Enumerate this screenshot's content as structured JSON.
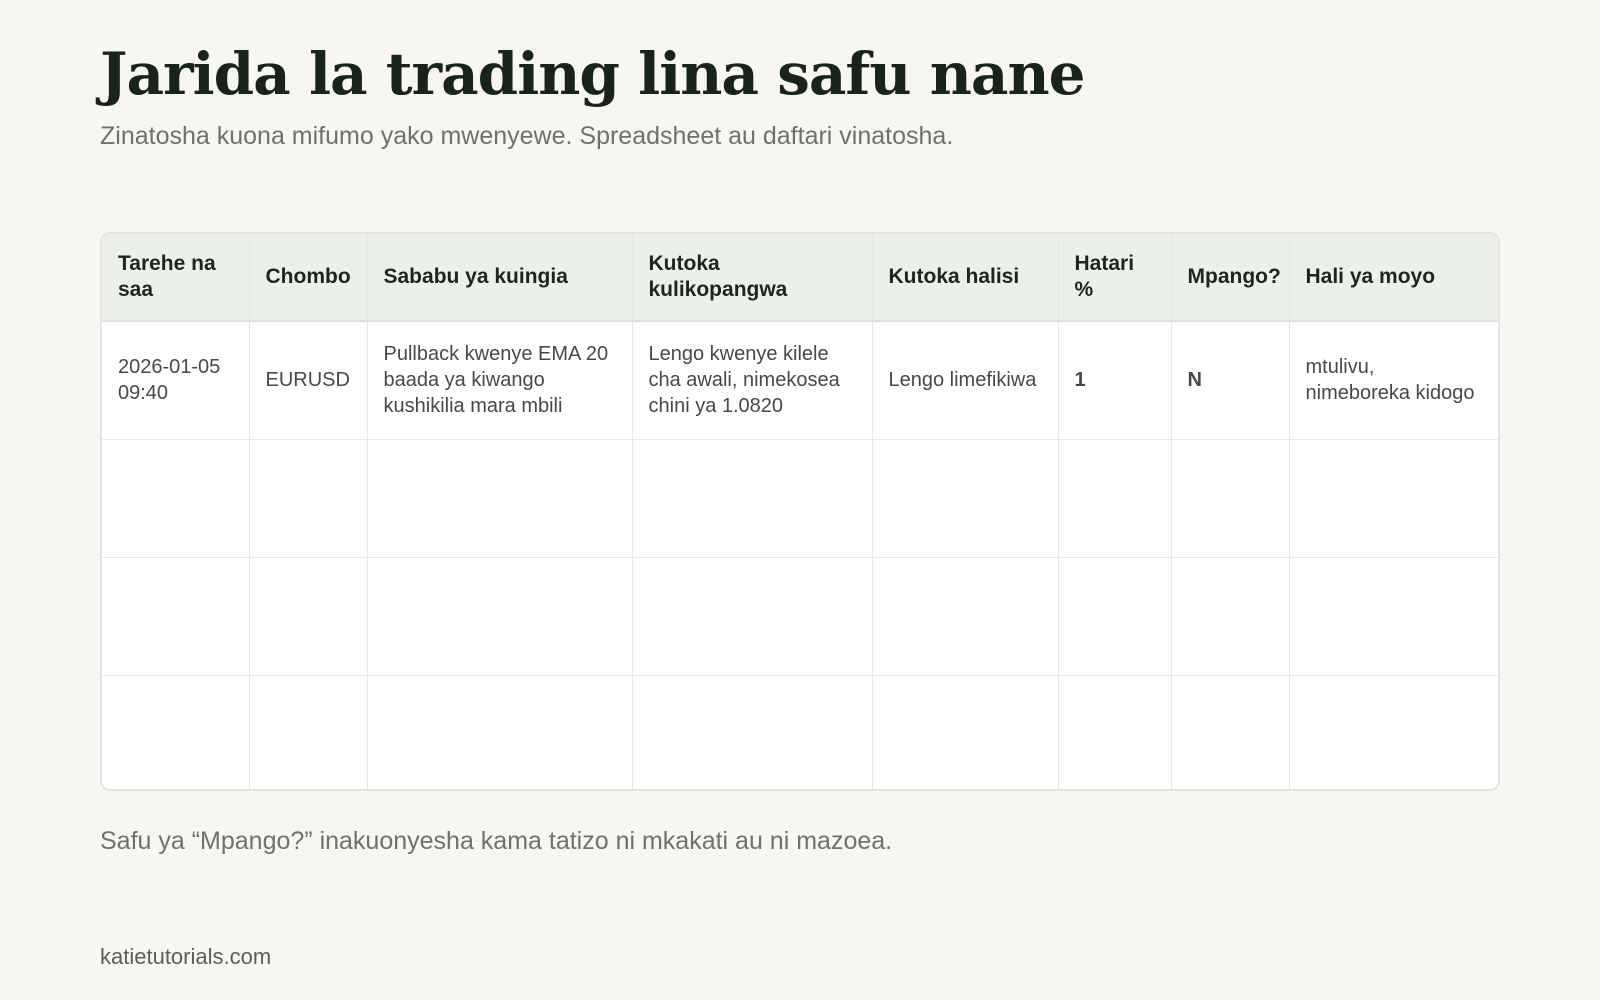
{
  "page": {
    "title": "Jarida la trading lina safu nane",
    "subtitle": "Zinatosha kuona mifumo yako mwenyewe. Spreadsheet au daftari vinatosha.",
    "note": "Safu ya “Mpango?” inakuonyesha kama tatizo ni mkakati au ni mazoea.",
    "site": "katietutorials.com"
  },
  "table": {
    "columns": [
      "Tarehe na saa",
      "Chombo",
      "Sababu ya kuingia",
      "Kutoka kulikopangwa",
      "Kutoka halisi",
      "Hatari %",
      "Mpango?",
      "Hali ya moyo"
    ],
    "rows": [
      [
        "2026-01-05 09:40",
        "EURUSD",
        "Pullback kwenye EMA 20 baada ya kiwango kushikilia mara mbili",
        "Lengo kwenye kilele cha awali, nimekosea chini ya 1.0820",
        "Lengo limefikiwa",
        "1",
        "N",
        "mtulivu, nimeboreka kidogo"
      ],
      [
        "",
        "",
        "",
        "",
        "",
        "",
        "",
        ""
      ],
      [
        "",
        "",
        "",
        "",
        "",
        "",
        "",
        ""
      ],
      [
        "",
        "",
        "",
        "",
        "",
        "",
        "",
        ""
      ]
    ]
  },
  "colors": {
    "background": "#f7f6f2",
    "header_bg": "#ecf0eb",
    "plan_accent": "#17876a",
    "title": "#18231d",
    "muted_text": "#6f716b"
  }
}
